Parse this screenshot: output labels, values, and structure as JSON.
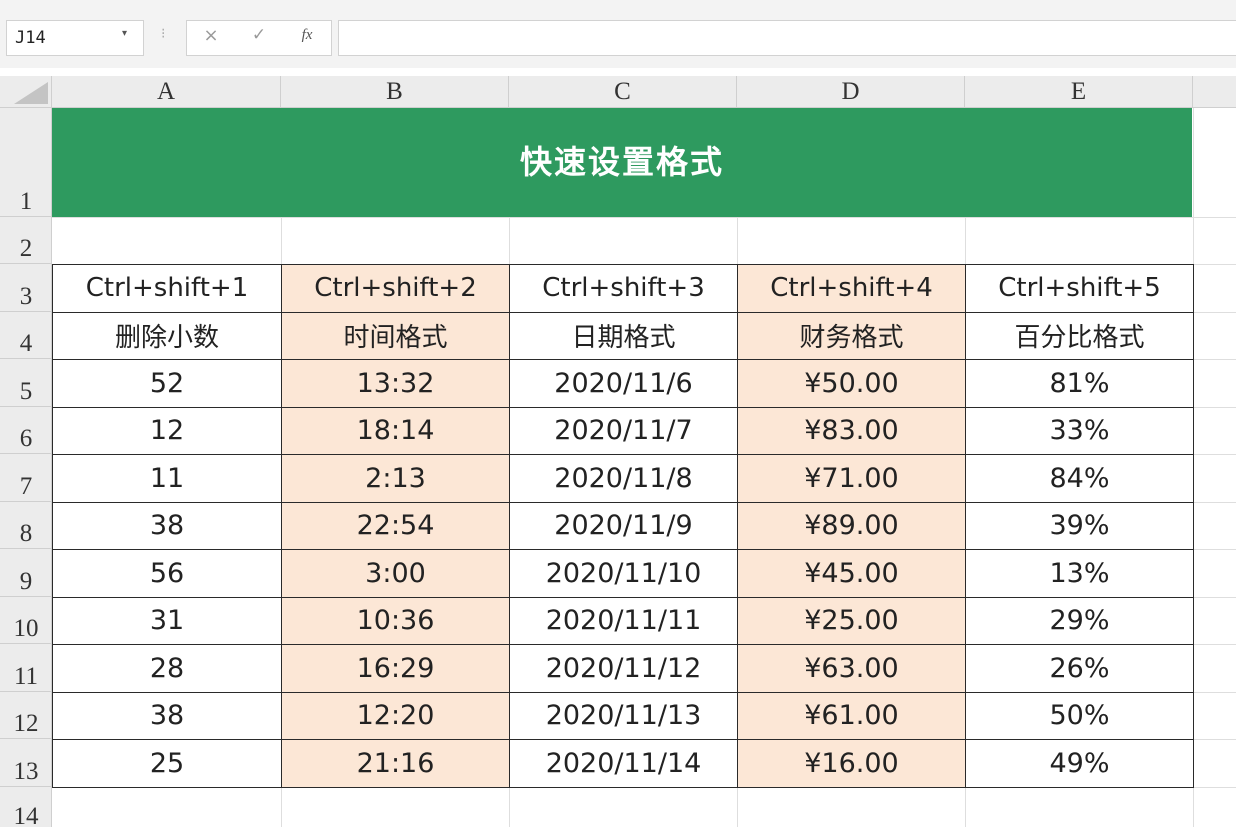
{
  "formula_bar": {
    "name_box": "J14",
    "name_box_arrow": "▾",
    "separator": "⁝",
    "cancel_symbol": "×",
    "enter_symbol": "✓",
    "fx_symbol": "fx",
    "formula": ""
  },
  "columns": [
    "A",
    "B",
    "C",
    "D",
    "E"
  ],
  "rows": [
    "1",
    "2",
    "3",
    "4",
    "5",
    "6",
    "7",
    "8",
    "9",
    "10",
    "11",
    "12",
    "13",
    "14"
  ],
  "title": "快速设置格式",
  "table": {
    "shortcuts": [
      "Ctrl+shift+1",
      "Ctrl+shift+2",
      "Ctrl+shift+3",
      "Ctrl+shift+4",
      "Ctrl+shift+5"
    ],
    "formats": [
      "删除小数",
      "时间格式",
      "日期格式",
      "财务格式",
      "百分比格式"
    ],
    "data": [
      [
        "52",
        "13:32",
        "2020/11/6",
        "¥50.00",
        "81%"
      ],
      [
        "12",
        "18:14",
        "2020/11/7",
        "¥83.00",
        "33%"
      ],
      [
        "11",
        "2:13",
        "2020/11/8",
        "¥71.00",
        "84%"
      ],
      [
        "38",
        "22:54",
        "2020/11/9",
        "¥89.00",
        "39%"
      ],
      [
        "56",
        "3:00",
        "2020/11/10",
        "¥45.00",
        "13%"
      ],
      [
        "31",
        "10:36",
        "2020/11/11",
        "¥25.00",
        "29%"
      ],
      [
        "28",
        "16:29",
        "2020/11/12",
        "¥63.00",
        "26%"
      ],
      [
        "38",
        "12:20",
        "2020/11/13",
        "¥61.00",
        "50%"
      ],
      [
        "25",
        "21:16",
        "2020/11/14",
        "¥16.00",
        "49%"
      ]
    ]
  },
  "colors": {
    "title_bg": "#2e9a5f",
    "shade": "#fce7d6",
    "header_bg": "#ececec"
  }
}
